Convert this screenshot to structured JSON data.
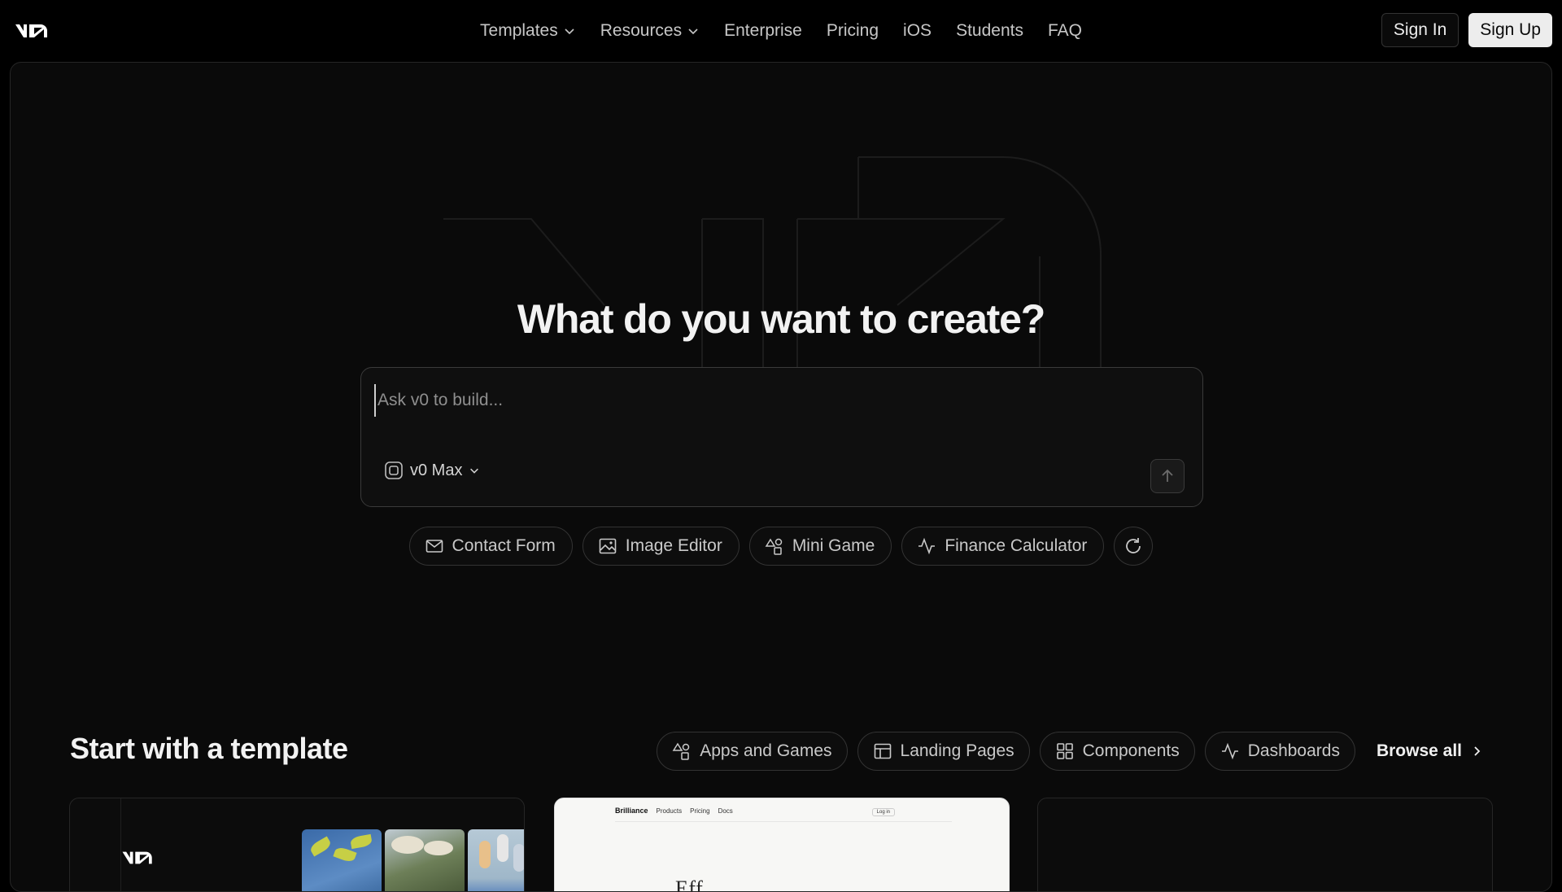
{
  "nav": {
    "links": [
      {
        "label": "Templates",
        "dropdown": true
      },
      {
        "label": "Resources",
        "dropdown": true
      },
      {
        "label": "Enterprise"
      },
      {
        "label": "Pricing"
      },
      {
        "label": "iOS"
      },
      {
        "label": "Students"
      },
      {
        "label": "FAQ"
      }
    ],
    "sign_in": "Sign In",
    "sign_up": "Sign Up"
  },
  "hero": {
    "title": "What do you want to create?",
    "prompt_placeholder": "Ask v0 to build...",
    "model_label": "v0 Max",
    "suggestions": [
      {
        "label": "Contact Form",
        "icon": "mail-icon"
      },
      {
        "label": "Image Editor",
        "icon": "image-icon"
      },
      {
        "label": "Mini Game",
        "icon": "shapes-icon"
      },
      {
        "label": "Finance Calculator",
        "icon": "activity-icon"
      }
    ]
  },
  "templates": {
    "title": "Start with a template",
    "filters": [
      {
        "label": "Apps and Games",
        "icon": "shapes-icon"
      },
      {
        "label": "Landing Pages",
        "icon": "layout-icon"
      },
      {
        "label": "Components",
        "icon": "grid-icon"
      },
      {
        "label": "Dashboards",
        "icon": "activity-icon"
      }
    ],
    "browse_all": "Browse all",
    "card2": {
      "brand": "Brilliance",
      "nav": [
        "Products",
        "Pricing",
        "Docs"
      ],
      "button": "Log in",
      "headline": "Eff..."
    }
  },
  "colors": {
    "background": "#000000",
    "panel": "#0a0a0a",
    "border": "#262626",
    "text": "#ededed",
    "muted": "#8f8f8f",
    "signup_bg": "#ededed"
  }
}
